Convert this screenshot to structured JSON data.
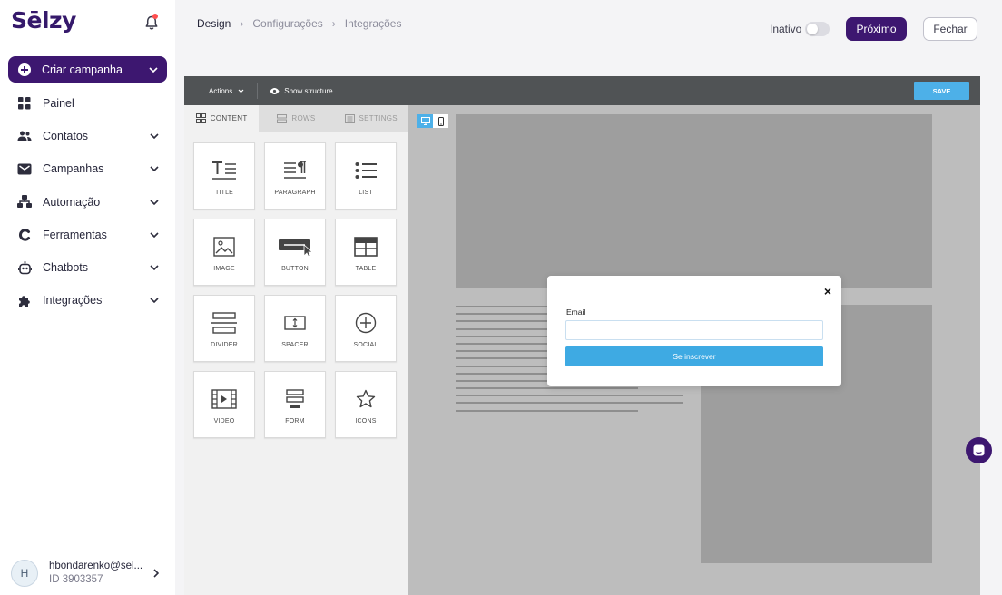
{
  "app": {
    "logo": "Sēlzy"
  },
  "sidebar": {
    "create_label": "Criar campanha",
    "items": [
      {
        "label": "Painel",
        "icon": "dashboard-icon",
        "expandable": false
      },
      {
        "label": "Contatos",
        "icon": "contacts-icon",
        "expandable": true
      },
      {
        "label": "Campanhas",
        "icon": "mail-icon",
        "expandable": true
      },
      {
        "label": "Automação",
        "icon": "automation-icon",
        "expandable": true
      },
      {
        "label": "Ferramentas",
        "icon": "tools-icon",
        "expandable": true
      },
      {
        "label": "Chatbots",
        "icon": "chatbot-icon",
        "expandable": true
      },
      {
        "label": "Integrações",
        "icon": "puzzle-icon",
        "expandable": true
      }
    ],
    "user": {
      "initial": "H",
      "email": "hbondarenko@sel...",
      "id": "ID 3903357"
    }
  },
  "header": {
    "breadcrumb": [
      "Design",
      "Configurações",
      "Integrações"
    ],
    "status": "Inativo",
    "next_label": "Próximo",
    "close_label": "Fechar"
  },
  "editor": {
    "actions_label": "Actions",
    "structure_label": "Show structure",
    "save_label": "SAVE",
    "tabs": [
      "CONTENT",
      "ROWS",
      "SETTINGS"
    ],
    "blocks": [
      "TITLE",
      "PARAGRAPH",
      "LIST",
      "IMAGE",
      "BUTTON",
      "TABLE",
      "DIVIDER",
      "SPACER",
      "SOCIAL",
      "VIDEO",
      "FORM",
      "ICONS"
    ]
  },
  "popup": {
    "close": "×",
    "email_label": "Email",
    "button_label": "Se inscrever"
  },
  "colors": {
    "brand": "#3d1770",
    "accent": "#4db0e8",
    "button": "#3eaae3"
  }
}
